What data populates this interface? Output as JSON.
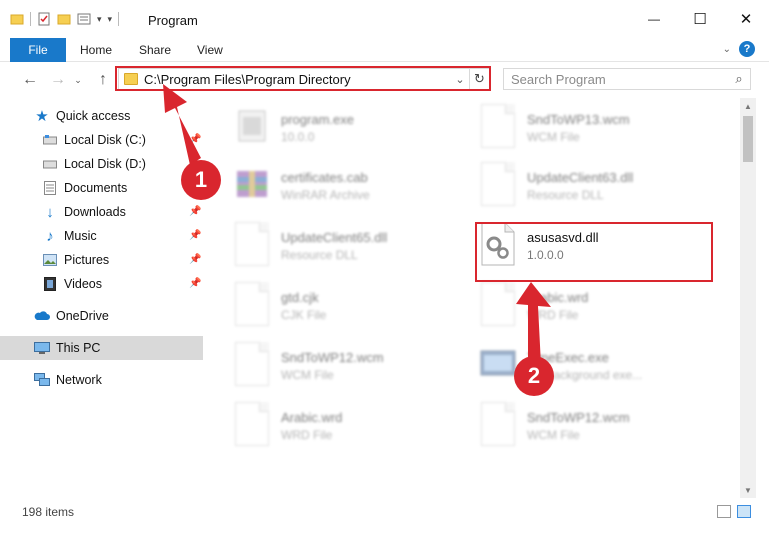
{
  "window": {
    "title": "Program",
    "controls": {
      "minimize": "—",
      "maximize": "☐",
      "close": "✕"
    }
  },
  "ribbon": {
    "tabs": [
      "File",
      "Home",
      "Share",
      "View"
    ]
  },
  "nav": {
    "address": "C:\\Program Files\\Program Directory",
    "search_placeholder": "Search Program"
  },
  "sidebar": {
    "items": [
      {
        "label": "Quick access",
        "icon": "star-icon",
        "pinned": false
      },
      {
        "label": "Local Disk (C:)",
        "icon": "drive-icon",
        "pinned": true
      },
      {
        "label": "Local Disk (D:)",
        "icon": "drive-icon",
        "pinned": false
      },
      {
        "label": "Documents",
        "icon": "documents-icon",
        "pinned": false
      },
      {
        "label": "Downloads",
        "icon": "download-icon",
        "pinned": true
      },
      {
        "label": "Music",
        "icon": "music-icon",
        "pinned": true
      },
      {
        "label": "Pictures",
        "icon": "pictures-icon",
        "pinned": true
      },
      {
        "label": "Videos",
        "icon": "videos-icon",
        "pinned": true
      },
      {
        "label": "OneDrive",
        "icon": "cloud-icon",
        "pinned": false
      },
      {
        "label": "This PC",
        "icon": "computer-icon",
        "pinned": false,
        "selected": true
      },
      {
        "label": "Network",
        "icon": "network-icon",
        "pinned": false
      }
    ]
  },
  "files": [
    {
      "name": "program.exe",
      "sub": "10.0.0",
      "icon": "exe-icon"
    },
    {
      "name": "SndToWP13.wcm",
      "sub": "WCM File",
      "icon": "file-icon"
    },
    {
      "name": "certificates.cab",
      "sub": "WinRAR Archive",
      "icon": "archive-icon"
    },
    {
      "name": "UpdateClient63.dll",
      "sub": "Resource DLL",
      "icon": "dll-icon"
    },
    {
      "name": "UpdateClient65.dll",
      "sub": "Resource DLL",
      "icon": "dll-icon"
    },
    {
      "name": "asusasvd.dll",
      "sub": "1.0.0.0",
      "icon": "dll-icon",
      "highlighted": true
    },
    {
      "name": "gtd.cjk",
      "sub": "CJK File",
      "icon": "file-icon"
    },
    {
      "name": "Arabic.wrd",
      "sub": "WRD File",
      "icon": "file-icon"
    },
    {
      "name": "SndToWP12.wcm",
      "sub": "WCM File",
      "icon": "file-icon"
    },
    {
      "name": "TimeExec.exe",
      "sub": "HP background exe...",
      "icon": "exe-icon"
    },
    {
      "name": "Arabic.wrd",
      "sub": "WRD File",
      "icon": "file-icon"
    },
    {
      "name": "SndToWP12.wcm",
      "sub": "WCM File",
      "icon": "file-icon"
    }
  ],
  "status": {
    "item_count": "198 items"
  },
  "callouts": [
    "1",
    "2"
  ],
  "colors": {
    "accent": "#1979ca",
    "highlight": "#d9262e",
    "folder": "#f6cf52"
  }
}
